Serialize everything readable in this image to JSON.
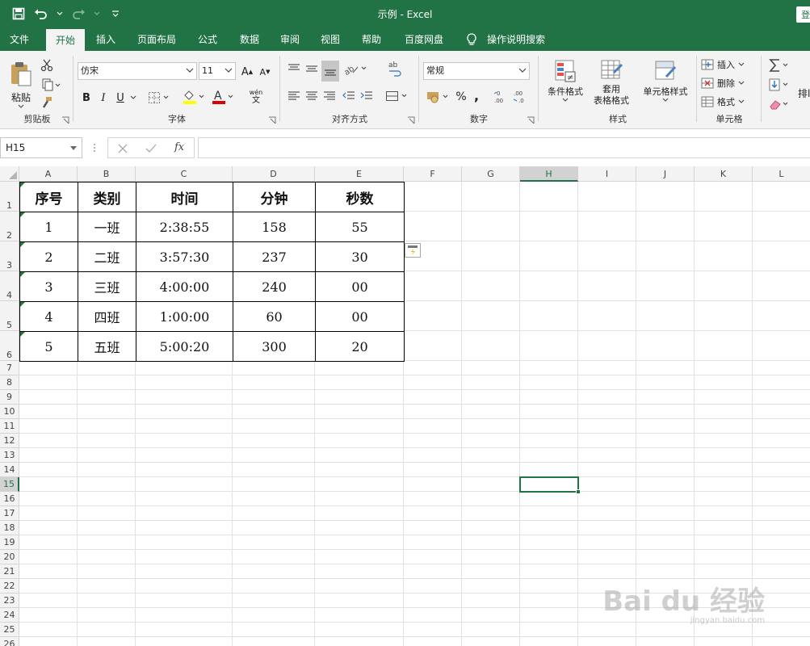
{
  "window": {
    "title": "示例  -  Excel",
    "signin": "登"
  },
  "tabs": [
    "文件",
    "开始",
    "插入",
    "页面布局",
    "公式",
    "数据",
    "审阅",
    "视图",
    "帮助",
    "百度网盘",
    "操作说明搜索"
  ],
  "ribbon": {
    "clipboard": {
      "label": "剪贴板",
      "paste": "粘贴"
    },
    "font": {
      "label": "字体",
      "name": "仿宋",
      "size": "11",
      "bold": "B",
      "italic": "I",
      "underline": "U",
      "grow": "A",
      "shrink": "A",
      "fontcolor": "A",
      "phonetic_top": "wén",
      "phonetic_bottom": "文"
    },
    "alignment": {
      "label": "对齐方式",
      "wrap": "ab"
    },
    "number": {
      "label": "数字",
      "format": "常规",
      "percent": "%",
      "comma": ","
    },
    "styles": {
      "label": "样式",
      "cond": "条件格式",
      "table_1": "套用",
      "table_2": "表格格式",
      "cellstyle": "单元格样式"
    },
    "cells": {
      "label": "单元格",
      "insert": "插入",
      "delete": "删除",
      "format": "格式"
    },
    "editing": {
      "sort_partial": "排l"
    }
  },
  "formula_bar": {
    "namebox": "H15",
    "fx": "fx",
    "value": ""
  },
  "columns": [
    "A",
    "B",
    "C",
    "D",
    "E",
    "F",
    "G",
    "H",
    "I",
    "J",
    "K",
    "L"
  ],
  "selected": {
    "column": "H",
    "row": "15"
  },
  "rows": [
    "1",
    "2",
    "3",
    "4",
    "5",
    "6",
    "7",
    "8",
    "9",
    "10",
    "11",
    "12",
    "13",
    "14",
    "15",
    "16",
    "17",
    "18",
    "19",
    "20",
    "21",
    "22",
    "23",
    "24",
    "25",
    "26"
  ],
  "table": {
    "headers": [
      "序号",
      "类别",
      "时间",
      "分钟",
      "秒数"
    ],
    "rows": [
      [
        "1",
        "一班",
        "2:38:55",
        "158",
        "55"
      ],
      [
        "2",
        "二班",
        "3:57:30",
        "237",
        "30"
      ],
      [
        "3",
        "三班",
        "4:00:00",
        "240",
        "00"
      ],
      [
        "4",
        "四班",
        "1:00:00",
        "60",
        "00"
      ],
      [
        "5",
        "五班",
        "5:00:20",
        "300",
        "20"
      ]
    ]
  },
  "watermark": {
    "brand": "Bai du 经验",
    "url": "jingyan.baidu.com"
  },
  "colors": {
    "accent": "#217346",
    "ribbon_bg": "#f3f3f3"
  }
}
